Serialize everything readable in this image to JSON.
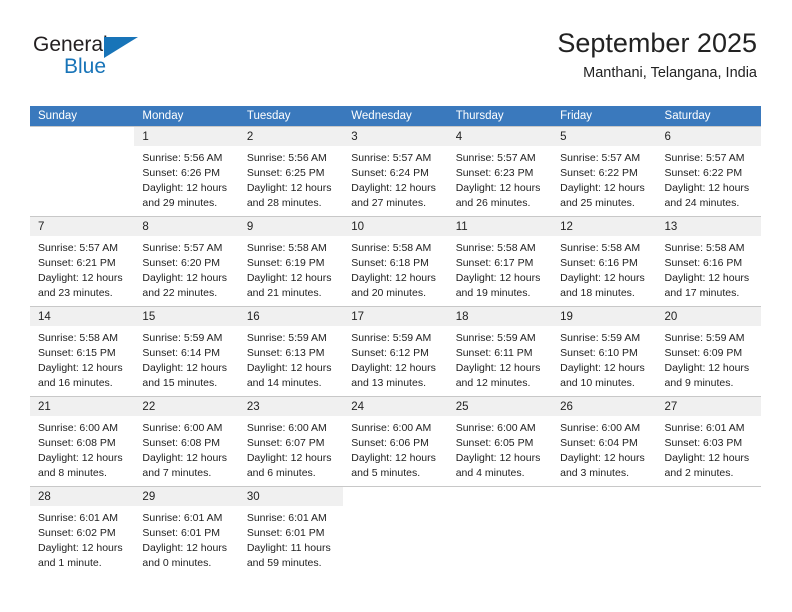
{
  "brand": {
    "word_general": "General",
    "word_blue": "Blue",
    "accent_color": "#1874b8"
  },
  "header": {
    "title": "September 2025",
    "subtitle": "Manthani, Telangana, India"
  },
  "calendar": {
    "header_bg": "#3a79bd",
    "daynum_bg": "#f0f0f0",
    "weekdays": [
      "Sunday",
      "Monday",
      "Tuesday",
      "Wednesday",
      "Thursday",
      "Friday",
      "Saturday"
    ],
    "weeks": [
      [
        {
          "day": "",
          "sunrise": "",
          "sunset": "",
          "daylight_line1": "",
          "daylight_line2": ""
        },
        {
          "day": "1",
          "sunrise": "Sunrise: 5:56 AM",
          "sunset": "Sunset: 6:26 PM",
          "daylight_line1": "Daylight: 12 hours",
          "daylight_line2": "and 29 minutes."
        },
        {
          "day": "2",
          "sunrise": "Sunrise: 5:56 AM",
          "sunset": "Sunset: 6:25 PM",
          "daylight_line1": "Daylight: 12 hours",
          "daylight_line2": "and 28 minutes."
        },
        {
          "day": "3",
          "sunrise": "Sunrise: 5:57 AM",
          "sunset": "Sunset: 6:24 PM",
          "daylight_line1": "Daylight: 12 hours",
          "daylight_line2": "and 27 minutes."
        },
        {
          "day": "4",
          "sunrise": "Sunrise: 5:57 AM",
          "sunset": "Sunset: 6:23 PM",
          "daylight_line1": "Daylight: 12 hours",
          "daylight_line2": "and 26 minutes."
        },
        {
          "day": "5",
          "sunrise": "Sunrise: 5:57 AM",
          "sunset": "Sunset: 6:22 PM",
          "daylight_line1": "Daylight: 12 hours",
          "daylight_line2": "and 25 minutes."
        },
        {
          "day": "6",
          "sunrise": "Sunrise: 5:57 AM",
          "sunset": "Sunset: 6:22 PM",
          "daylight_line1": "Daylight: 12 hours",
          "daylight_line2": "and 24 minutes."
        }
      ],
      [
        {
          "day": "7",
          "sunrise": "Sunrise: 5:57 AM",
          "sunset": "Sunset: 6:21 PM",
          "daylight_line1": "Daylight: 12 hours",
          "daylight_line2": "and 23 minutes."
        },
        {
          "day": "8",
          "sunrise": "Sunrise: 5:57 AM",
          "sunset": "Sunset: 6:20 PM",
          "daylight_line1": "Daylight: 12 hours",
          "daylight_line2": "and 22 minutes."
        },
        {
          "day": "9",
          "sunrise": "Sunrise: 5:58 AM",
          "sunset": "Sunset: 6:19 PM",
          "daylight_line1": "Daylight: 12 hours",
          "daylight_line2": "and 21 minutes."
        },
        {
          "day": "10",
          "sunrise": "Sunrise: 5:58 AM",
          "sunset": "Sunset: 6:18 PM",
          "daylight_line1": "Daylight: 12 hours",
          "daylight_line2": "and 20 minutes."
        },
        {
          "day": "11",
          "sunrise": "Sunrise: 5:58 AM",
          "sunset": "Sunset: 6:17 PM",
          "daylight_line1": "Daylight: 12 hours",
          "daylight_line2": "and 19 minutes."
        },
        {
          "day": "12",
          "sunrise": "Sunrise: 5:58 AM",
          "sunset": "Sunset: 6:16 PM",
          "daylight_line1": "Daylight: 12 hours",
          "daylight_line2": "and 18 minutes."
        },
        {
          "day": "13",
          "sunrise": "Sunrise: 5:58 AM",
          "sunset": "Sunset: 6:16 PM",
          "daylight_line1": "Daylight: 12 hours",
          "daylight_line2": "and 17 minutes."
        }
      ],
      [
        {
          "day": "14",
          "sunrise": "Sunrise: 5:58 AM",
          "sunset": "Sunset: 6:15 PM",
          "daylight_line1": "Daylight: 12 hours",
          "daylight_line2": "and 16 minutes."
        },
        {
          "day": "15",
          "sunrise": "Sunrise: 5:59 AM",
          "sunset": "Sunset: 6:14 PM",
          "daylight_line1": "Daylight: 12 hours",
          "daylight_line2": "and 15 minutes."
        },
        {
          "day": "16",
          "sunrise": "Sunrise: 5:59 AM",
          "sunset": "Sunset: 6:13 PM",
          "daylight_line1": "Daylight: 12 hours",
          "daylight_line2": "and 14 minutes."
        },
        {
          "day": "17",
          "sunrise": "Sunrise: 5:59 AM",
          "sunset": "Sunset: 6:12 PM",
          "daylight_line1": "Daylight: 12 hours",
          "daylight_line2": "and 13 minutes."
        },
        {
          "day": "18",
          "sunrise": "Sunrise: 5:59 AM",
          "sunset": "Sunset: 6:11 PM",
          "daylight_line1": "Daylight: 12 hours",
          "daylight_line2": "and 12 minutes."
        },
        {
          "day": "19",
          "sunrise": "Sunrise: 5:59 AM",
          "sunset": "Sunset: 6:10 PM",
          "daylight_line1": "Daylight: 12 hours",
          "daylight_line2": "and 10 minutes."
        },
        {
          "day": "20",
          "sunrise": "Sunrise: 5:59 AM",
          "sunset": "Sunset: 6:09 PM",
          "daylight_line1": "Daylight: 12 hours",
          "daylight_line2": "and 9 minutes."
        }
      ],
      [
        {
          "day": "21",
          "sunrise": "Sunrise: 6:00 AM",
          "sunset": "Sunset: 6:08 PM",
          "daylight_line1": "Daylight: 12 hours",
          "daylight_line2": "and 8 minutes."
        },
        {
          "day": "22",
          "sunrise": "Sunrise: 6:00 AM",
          "sunset": "Sunset: 6:08 PM",
          "daylight_line1": "Daylight: 12 hours",
          "daylight_line2": "and 7 minutes."
        },
        {
          "day": "23",
          "sunrise": "Sunrise: 6:00 AM",
          "sunset": "Sunset: 6:07 PM",
          "daylight_line1": "Daylight: 12 hours",
          "daylight_line2": "and 6 minutes."
        },
        {
          "day": "24",
          "sunrise": "Sunrise: 6:00 AM",
          "sunset": "Sunset: 6:06 PM",
          "daylight_line1": "Daylight: 12 hours",
          "daylight_line2": "and 5 minutes."
        },
        {
          "day": "25",
          "sunrise": "Sunrise: 6:00 AM",
          "sunset": "Sunset: 6:05 PM",
          "daylight_line1": "Daylight: 12 hours",
          "daylight_line2": "and 4 minutes."
        },
        {
          "day": "26",
          "sunrise": "Sunrise: 6:00 AM",
          "sunset": "Sunset: 6:04 PM",
          "daylight_line1": "Daylight: 12 hours",
          "daylight_line2": "and 3 minutes."
        },
        {
          "day": "27",
          "sunrise": "Sunrise: 6:01 AM",
          "sunset": "Sunset: 6:03 PM",
          "daylight_line1": "Daylight: 12 hours",
          "daylight_line2": "and 2 minutes."
        }
      ],
      [
        {
          "day": "28",
          "sunrise": "Sunrise: 6:01 AM",
          "sunset": "Sunset: 6:02 PM",
          "daylight_line1": "Daylight: 12 hours",
          "daylight_line2": "and 1 minute."
        },
        {
          "day": "29",
          "sunrise": "Sunrise: 6:01 AM",
          "sunset": "Sunset: 6:01 PM",
          "daylight_line1": "Daylight: 12 hours",
          "daylight_line2": "and 0 minutes."
        },
        {
          "day": "30",
          "sunrise": "Sunrise: 6:01 AM",
          "sunset": "Sunset: 6:01 PM",
          "daylight_line1": "Daylight: 11 hours",
          "daylight_line2": "and 59 minutes."
        },
        {
          "day": "",
          "sunrise": "",
          "sunset": "",
          "daylight_line1": "",
          "daylight_line2": ""
        },
        {
          "day": "",
          "sunrise": "",
          "sunset": "",
          "daylight_line1": "",
          "daylight_line2": ""
        },
        {
          "day": "",
          "sunrise": "",
          "sunset": "",
          "daylight_line1": "",
          "daylight_line2": ""
        },
        {
          "day": "",
          "sunrise": "",
          "sunset": "",
          "daylight_line1": "",
          "daylight_line2": ""
        }
      ]
    ]
  }
}
